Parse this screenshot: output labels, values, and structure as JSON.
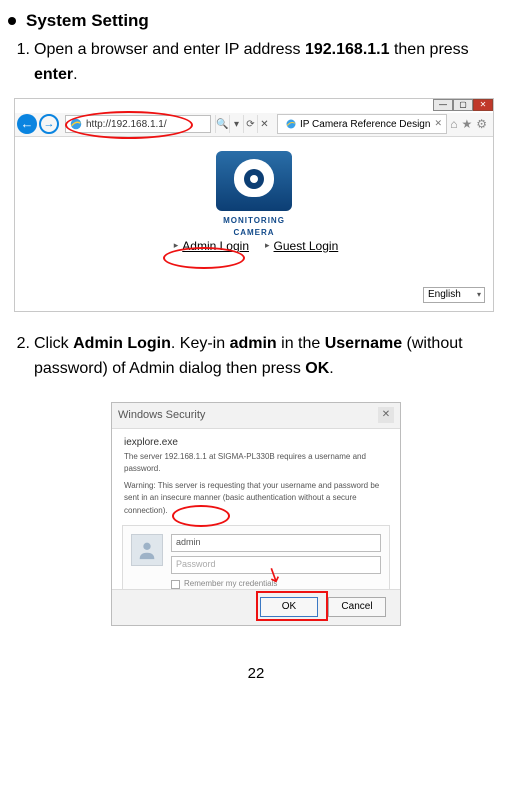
{
  "heading": "System Setting",
  "step1": {
    "num": "1.",
    "t1": "Open a browser and enter IP address ",
    "ip": "192.168.1.1",
    "t2": " then press ",
    "enter": "enter",
    "t3": "."
  },
  "shot1": {
    "url": "http://192.168.1.1/",
    "search_icon": "🔍",
    "tab_label": "IP Camera Reference Design",
    "logo_text": "MONITORING  CAMERA",
    "admin_login": "Admin Login",
    "guest_login": "Guest Login",
    "lang": "English"
  },
  "step2": {
    "num": "2.",
    "t1": "Click ",
    "admin_login": "Admin Login",
    "t2": ".   Key-in ",
    "admin": "admin",
    "t3": " in the ",
    "username": "Username",
    "t4": " (without password) of Admin dialog then press ",
    "ok": "OK",
    "t5": "."
  },
  "shot2": {
    "title": "Windows Security",
    "app": "iexplore.exe",
    "line1": "The server 192.168.1.1 at SIGMA-PL330B requires a username and password.",
    "line2": "Warning: This server is requesting that your username and password be sent in an insecure manner (basic authentication without a secure connection).",
    "user_value": "admin",
    "pass_placeholder": "Password",
    "remember": "Remember my credentials",
    "ok": "OK",
    "cancel": "Cancel"
  },
  "page": "22"
}
